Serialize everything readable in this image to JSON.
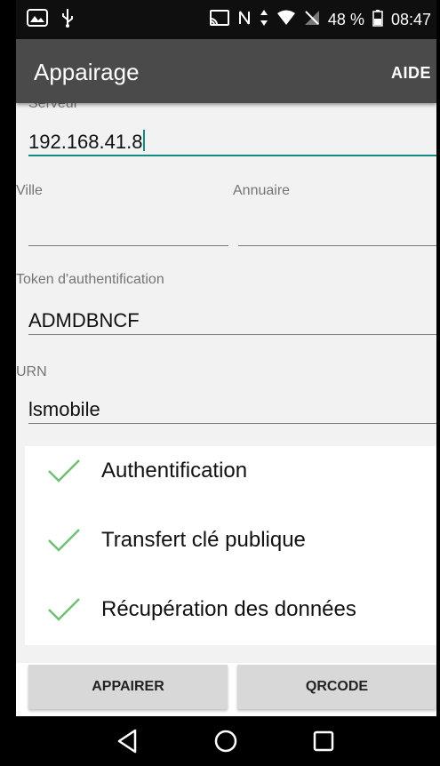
{
  "status_bar": {
    "battery": "48 %",
    "time": "08:47"
  },
  "app_bar": {
    "title": "Appairage",
    "help": "AIDE"
  },
  "form": {
    "server_label": "Serveur",
    "server_value": "192.168.41.8",
    "city_label": "Ville",
    "city_value": "",
    "directory_label": "Annuaire",
    "directory_value": "",
    "token_label": "Token d'authentification",
    "token_value": "ADMDBNCF",
    "urn_label": "URN",
    "urn_value": "lsmobile"
  },
  "steps": [
    {
      "label": "Authentification",
      "done": true
    },
    {
      "label": "Transfert clé publique",
      "done": true
    },
    {
      "label": "Récupération des données",
      "done": true
    }
  ],
  "buttons": {
    "pair": "APPAIRER",
    "qrcode": "QRCODE"
  },
  "colors": {
    "accent": "#138b80",
    "check": "#6fbf73",
    "app_bar": "#4a4a4a"
  }
}
